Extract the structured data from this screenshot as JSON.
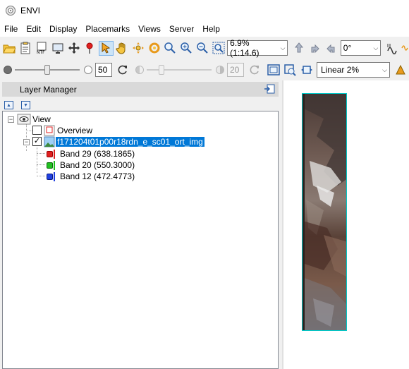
{
  "app": {
    "title": "ENVI"
  },
  "menu": [
    "File",
    "Edit",
    "Display",
    "Placemarks",
    "Views",
    "Server",
    "Help"
  ],
  "toolbar1": {
    "zoom_value": "6.9% (1:14.6)",
    "rotation_value": "0°"
  },
  "toolbar2": {
    "brightness_value": "50",
    "brightness_level": 0.5,
    "transparency_value": "20",
    "transparency_level": 0.2,
    "stretch_value": "Linear 2%"
  },
  "layer_manager": {
    "title": "Layer Manager",
    "view_label": "View",
    "overview_label": "Overview",
    "overview_checked": false,
    "raster_label": "f171204t01p00r18rdn_e_sc01_ort_img",
    "raster_checked": true,
    "bands": [
      {
        "label": "Band 29 (638.1865)",
        "color": "#e02020"
      },
      {
        "label": "Band 20 (550.3000)",
        "color": "#20c020"
      },
      {
        "label": "Band 12 (472.4773)",
        "color": "#2040e0"
      }
    ]
  },
  "colors": {
    "selection": "#0078d7",
    "image_border": "#00c8c8"
  }
}
